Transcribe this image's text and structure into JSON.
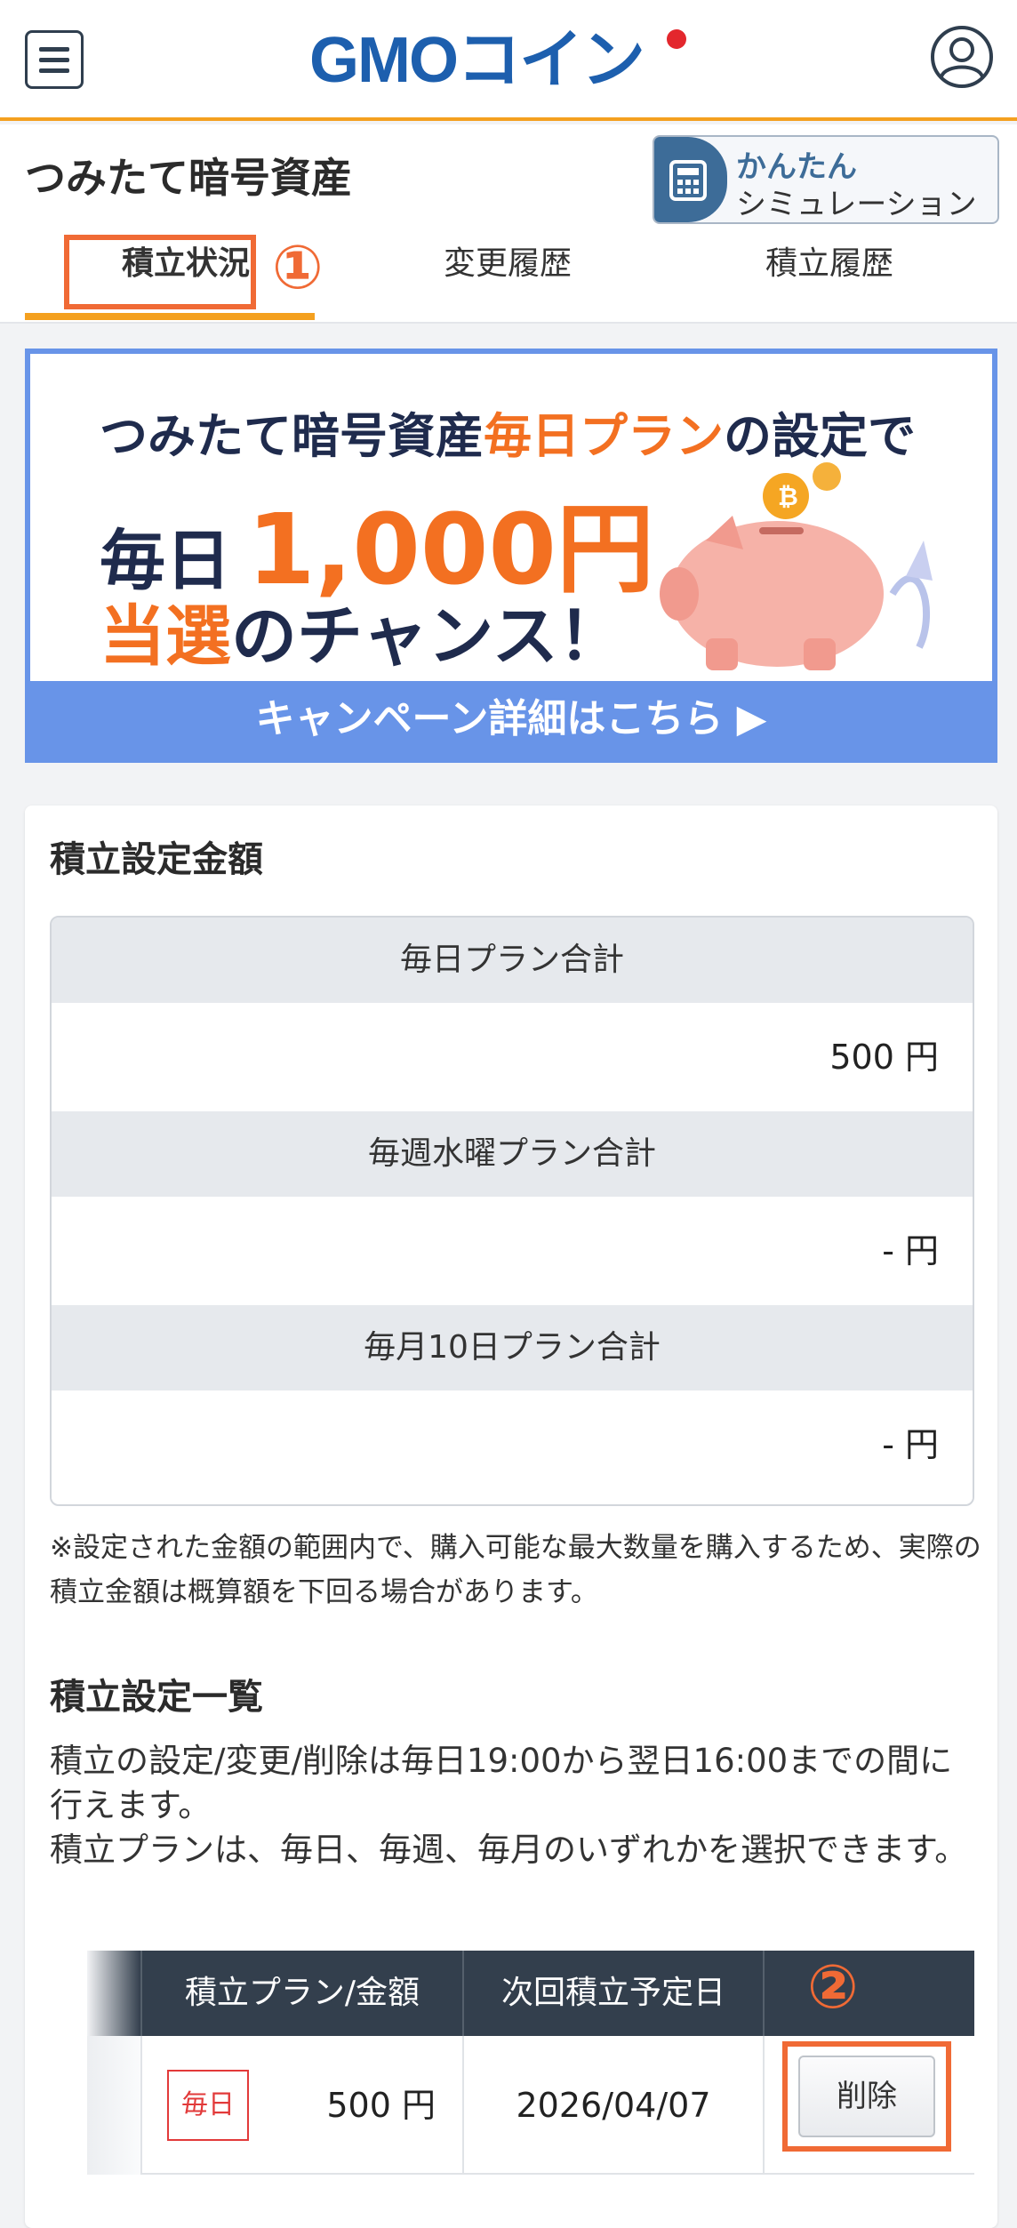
{
  "header": {
    "logo_text": "GMOコイン",
    "menu_icon": "hamburger-menu-icon",
    "user_icon": "user-account-icon"
  },
  "page": {
    "title": "つみたて暗号資産",
    "simulation_button": {
      "line1": "かんたん",
      "line2": "シミュレーション",
      "icon": "calculator-icon"
    }
  },
  "tabs": [
    {
      "label": "積立状況",
      "active": true
    },
    {
      "label": "変更履歴",
      "active": false
    },
    {
      "label": "積立履歴",
      "active": false
    }
  ],
  "annotations": {
    "marker1": "①",
    "marker2": "②"
  },
  "banner": {
    "line1_pre": "つみたて暗号資産",
    "line1_highlight": "毎日プラン",
    "line1_post": "の設定で",
    "line2_every": "毎日",
    "line2_amount": "1,000円",
    "line3_highlight": "当選",
    "line3_post": "のチャンス！",
    "cta": "キャンペーン詳細はこちら ▶"
  },
  "amounts": {
    "section_title": "積立設定金額",
    "rows": [
      {
        "label": "毎日プラン合計",
        "value": "500 円"
      },
      {
        "label": "毎週水曜プラン合計",
        "value": "- 円"
      },
      {
        "label": "毎月10日プラン合計",
        "value": "- 円"
      }
    ],
    "note": "※設定された金額の範囲内で、購入可能な最大数量を購入するため、実際の積立金額は概算額を下回る場合があります。"
  },
  "settings": {
    "section_title": "積立設定一覧",
    "desc1": "積立の設定/変更/削除は毎日19:00から翌日16:00までの間に行えます。",
    "desc2": "積立プランは、毎日、毎週、毎月のいずれかを選択できます。",
    "columns": [
      "積立プラン/金額",
      "次回積立予定日",
      ""
    ],
    "rows": [
      {
        "badge": "毎日",
        "amount": "500 円",
        "next_date": "2026/04/07",
        "action": "削除"
      }
    ]
  },
  "colors": {
    "accent_orange": "#f4a01f",
    "annotation_orange": "#f06a35",
    "banner_blue": "#6894e8",
    "table_header": "#333f4d",
    "badge_red": "#e23a3a"
  }
}
